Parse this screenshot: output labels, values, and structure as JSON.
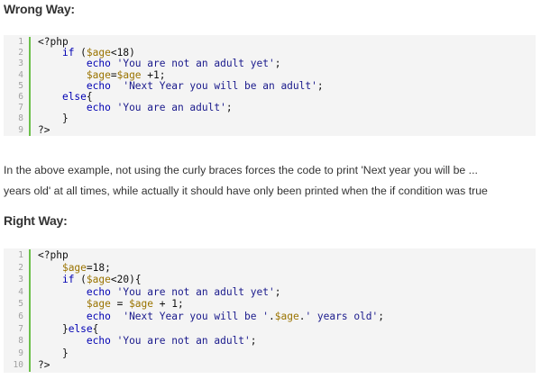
{
  "wrong_heading": "Wrong Way:",
  "right_heading": "Right Way:",
  "paragraph": [
    "In the above example, not using the curly braces forces the code to print 'Next year you will be ...",
    "years old' at all times, while actually it should have only been printed when the if condition was true"
  ],
  "wrong_code": [
    {
      "n": "1",
      "parts": [
        [
          "p",
          "<?php"
        ]
      ]
    },
    {
      "n": "2",
      "parts": [
        [
          "p",
          "    "
        ],
        [
          "kw",
          "if"
        ],
        [
          "p",
          " ("
        ],
        [
          "var",
          "$age"
        ],
        [
          "p",
          "<18)"
        ]
      ]
    },
    {
      "n": "3",
      "parts": [
        [
          "p",
          "        "
        ],
        [
          "kw",
          "echo"
        ],
        [
          "p",
          " "
        ],
        [
          "str",
          "'You are not an adult yet'"
        ],
        [
          "p",
          ";"
        ]
      ]
    },
    {
      "n": "4",
      "parts": [
        [
          "p",
          "        "
        ],
        [
          "var",
          "$age"
        ],
        [
          "p",
          "="
        ],
        [
          "var",
          "$age"
        ],
        [
          "p",
          " +1;"
        ]
      ]
    },
    {
      "n": "5",
      "parts": [
        [
          "p",
          "        "
        ],
        [
          "kw",
          "echo"
        ],
        [
          "p",
          "  "
        ],
        [
          "str",
          "'Next Year you will be an adult'"
        ],
        [
          "p",
          ";"
        ]
      ]
    },
    {
      "n": "6",
      "parts": [
        [
          "p",
          "    "
        ],
        [
          "kw",
          "else"
        ],
        [
          "p",
          "{"
        ]
      ]
    },
    {
      "n": "7",
      "parts": [
        [
          "p",
          "        "
        ],
        [
          "kw",
          "echo"
        ],
        [
          "p",
          " "
        ],
        [
          "str",
          "'You are an adult'"
        ],
        [
          "p",
          ";"
        ]
      ]
    },
    {
      "n": "8",
      "parts": [
        [
          "p",
          "    }"
        ]
      ]
    },
    {
      "n": "9",
      "parts": [
        [
          "p",
          "?>"
        ]
      ]
    }
  ],
  "right_code": [
    {
      "n": "1",
      "parts": [
        [
          "p",
          "<?php"
        ]
      ]
    },
    {
      "n": "2",
      "parts": [
        [
          "p",
          "    "
        ],
        [
          "var",
          "$age"
        ],
        [
          "p",
          "=18;"
        ]
      ]
    },
    {
      "n": "3",
      "parts": [
        [
          "p",
          "    "
        ],
        [
          "kw",
          "if"
        ],
        [
          "p",
          " ("
        ],
        [
          "var",
          "$age"
        ],
        [
          "p",
          "<20){"
        ]
      ]
    },
    {
      "n": "4",
      "parts": [
        [
          "p",
          "        "
        ],
        [
          "kw",
          "echo"
        ],
        [
          "p",
          " "
        ],
        [
          "str",
          "'You are not an adult yet'"
        ],
        [
          "p",
          ";"
        ]
      ]
    },
    {
      "n": "5",
      "parts": [
        [
          "p",
          "        "
        ],
        [
          "var",
          "$age"
        ],
        [
          "p",
          " = "
        ],
        [
          "var",
          "$age"
        ],
        [
          "p",
          " + 1;"
        ]
      ]
    },
    {
      "n": "6",
      "parts": [
        [
          "p",
          "        "
        ],
        [
          "kw",
          "echo"
        ],
        [
          "p",
          "  "
        ],
        [
          "str",
          "'Next Year you will be '"
        ],
        [
          "p",
          "."
        ],
        [
          "var",
          "$age"
        ],
        [
          "p",
          "."
        ],
        [
          "str",
          "' years old'"
        ],
        [
          "p",
          ";"
        ]
      ]
    },
    {
      "n": "7",
      "parts": [
        [
          "p",
          "    }"
        ],
        [
          "kw",
          "else"
        ],
        [
          "p",
          "{"
        ]
      ]
    },
    {
      "n": "8",
      "parts": [
        [
          "p",
          "        "
        ],
        [
          "kw",
          "echo"
        ],
        [
          "p",
          " "
        ],
        [
          "str",
          "'You are not an adult'"
        ],
        [
          "p",
          ";"
        ]
      ]
    },
    {
      "n": "9",
      "parts": [
        [
          "p",
          "    }"
        ]
      ]
    },
    {
      "n": "10",
      "parts": [
        [
          "p",
          "?>"
        ]
      ]
    }
  ]
}
